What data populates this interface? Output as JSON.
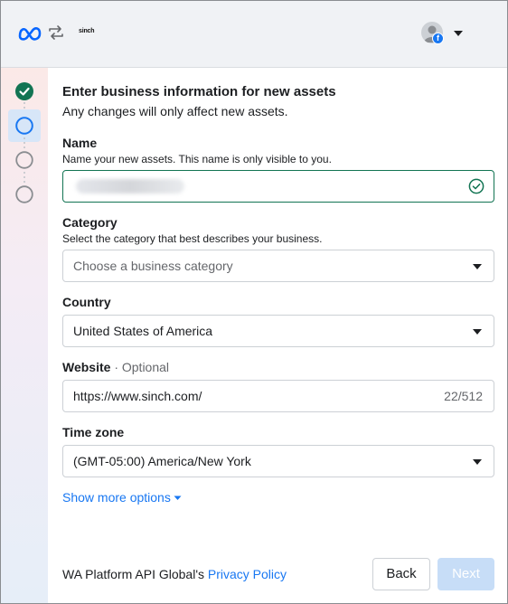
{
  "header": {
    "brand_logo": "meta-logo",
    "swap_icon": "swap-arrows-icon",
    "partner_logo_text": "sinch",
    "avatar_badge": "f"
  },
  "stepper": {
    "steps": [
      {
        "state": "completed"
      },
      {
        "state": "active"
      },
      {
        "state": "pending"
      },
      {
        "state": "pending"
      }
    ],
    "colors": {
      "completed": "#127453",
      "active": "#1877f2",
      "pending": "#8a8d91"
    }
  },
  "form": {
    "title": "Enter business information for new assets",
    "subtitle": "Any changes will only affect new assets.",
    "name": {
      "label": "Name",
      "help": "Name your new assets. This name is only visible to you.",
      "value": ""
    },
    "category": {
      "label": "Category",
      "help": "Select the category that best describes your business.",
      "placeholder": "Choose a business category"
    },
    "country": {
      "label": "Country",
      "value": "United States of America"
    },
    "website": {
      "label": "Website",
      "optional": " · Optional",
      "value": "https://www.sinch.com/",
      "counter": "22/512"
    },
    "timezone": {
      "label": "Time zone",
      "value": "(GMT-05:00) America/New York"
    },
    "show_more": "Show more options"
  },
  "footer": {
    "policy_prefix": "WA Platform API Global's ",
    "policy_link": "Privacy Policy",
    "back_label": "Back",
    "next_label": "Next"
  },
  "colors": {
    "accent": "#1877f2",
    "success": "#127453",
    "next_disabled_bg": "#c7ddf7"
  }
}
